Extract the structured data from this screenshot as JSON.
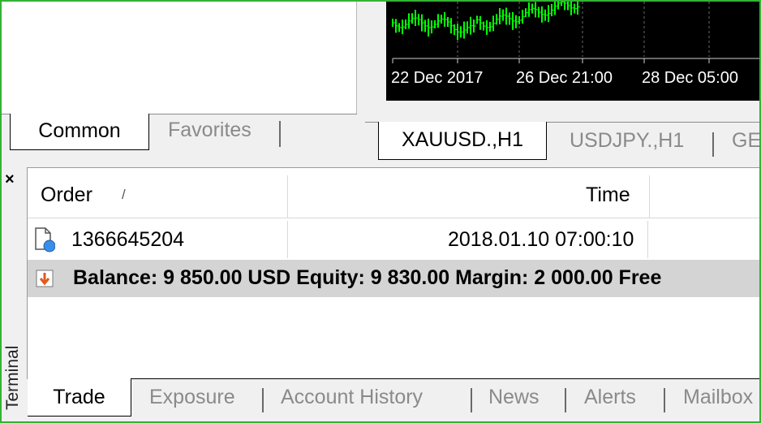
{
  "navigator": {
    "tabs": [
      {
        "label": "Common",
        "active": true
      },
      {
        "label": "Favorites",
        "active": false
      }
    ]
  },
  "chart": {
    "x_labels": [
      "22 Dec 2017",
      "26 Dec 21:00",
      "28 Dec 05:00"
    ],
    "line_color": "#00ff00",
    "tabs": [
      {
        "label": "XAUUSD.,H1",
        "active": true
      },
      {
        "label": "USDJPY.,H1",
        "active": false
      },
      {
        "label": "GE",
        "active": false
      }
    ]
  },
  "terminal": {
    "side_label": "Terminal",
    "close_glyph": "×",
    "columns": {
      "order": "Order",
      "sort_glyph": "/",
      "time": "Time"
    },
    "rows": [
      {
        "order": "1366645204",
        "time": "2018.01.10 07:00:10",
        "icon": "pending-order-icon"
      }
    ],
    "summary": {
      "icon": "balance-arrow-icon",
      "text": "Balance: 9 850.00 USD  Equity: 9 830.00  Margin: 2 000.00  Free"
    },
    "tabs": [
      {
        "label": "Trade",
        "active": true
      },
      {
        "label": "Exposure",
        "active": false
      },
      {
        "label": "Account History",
        "active": false
      },
      {
        "label": "News",
        "active": false
      },
      {
        "label": "Alerts",
        "active": false
      },
      {
        "label": "Mailbox",
        "active": false
      }
    ]
  }
}
